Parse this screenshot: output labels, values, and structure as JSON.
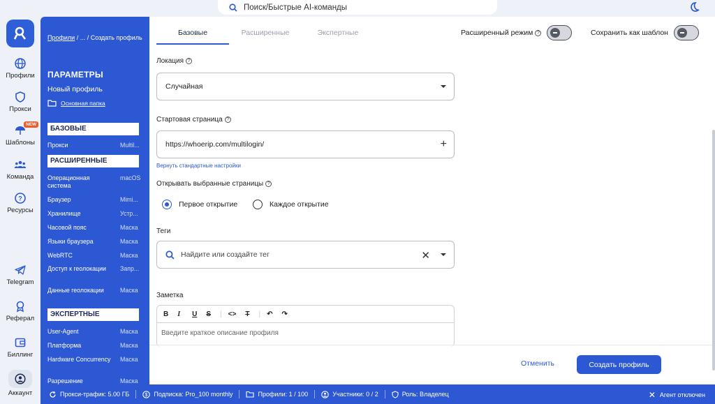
{
  "search": {
    "placeholder": "Поиск/Быстрые AI-команды"
  },
  "rail": {
    "items": [
      {
        "label": "Профили"
      },
      {
        "label": "Прокси"
      },
      {
        "label": "Шаблоны",
        "badge": "NEW"
      },
      {
        "label": "Команда"
      },
      {
        "label": "Ресурсы"
      },
      {
        "label": "Telegram"
      },
      {
        "label": "Реферал"
      },
      {
        "label": "Биллинг"
      },
      {
        "label": "Аккаунт"
      }
    ]
  },
  "sidebar": {
    "breadcrumb_link": "Профили",
    "breadcrumb_rest": " / ... / Создать профиль",
    "title": "ПАРАМЕТРЫ",
    "profile_name": "Новый профиль",
    "folder": "Основная папка",
    "sections": {
      "basic": "БАЗОВЫЕ",
      "advanced": "РАСШИРЕННЫЕ",
      "expert": "ЭКСПЕРТНЫЕ"
    },
    "basic_rows": [
      {
        "k": "Прокси",
        "v": "Multil..."
      }
    ],
    "advanced_rows": [
      {
        "k": "Операционная система",
        "v": "macOS"
      },
      {
        "k": "Браузер",
        "v": "Mimi..."
      },
      {
        "k": "Хранилище",
        "v": "Устр..."
      },
      {
        "k": "Часовой пояс",
        "v": "Маска"
      },
      {
        "k": "Языки браузера",
        "v": "Маска"
      },
      {
        "k": "WebRTC",
        "v": "Маска"
      },
      {
        "k": "Доступ к геолокации",
        "v": "Запр..."
      },
      {
        "k": "Данные геолокации",
        "v": "Маска"
      }
    ],
    "expert_rows": [
      {
        "k": "User-Agent",
        "v": "Маска"
      },
      {
        "k": "Платформа",
        "v": "Маска"
      },
      {
        "k": "Hardware Concurrency",
        "v": "Маска"
      },
      {
        "k": "Разрешение",
        "v": "Маска"
      }
    ]
  },
  "tabs": [
    "Базовые",
    "Расширенные",
    "Экспертные"
  ],
  "toggles": {
    "advanced_mode": "Расширенный режим",
    "save_template": "Сохранить как шаблон"
  },
  "form": {
    "location_label": "Локация",
    "location_value": "Случайная",
    "start_page_label": "Стартовая страница",
    "start_page_value": "https://whoerip.com/multilogin/",
    "reset_link": "Вернуть стандартные настройки",
    "open_pages_label": "Открывать выбранные страницы",
    "radio_first": "Первое открытие",
    "radio_every": "Каждое открытие",
    "tags_label": "Теги",
    "tags_placeholder": "Найдите или создайте тег",
    "note_label": "Заметка",
    "note_placeholder": "Введите краткое описание профиля"
  },
  "actions": {
    "cancel": "Отменить",
    "create": "Создать профиль"
  },
  "status": {
    "traffic": "Прокси-трафик: 5.00 ГБ",
    "subscription": "Подписка: Pro_100 monthly",
    "profiles": "Профили: 1 / 100",
    "members": "Участники: 0 / 2",
    "role": "Роль: Владелец",
    "agent": "Агент отключен"
  },
  "colors": {
    "accent": "#2c58d4",
    "badge": "#f05a28"
  }
}
